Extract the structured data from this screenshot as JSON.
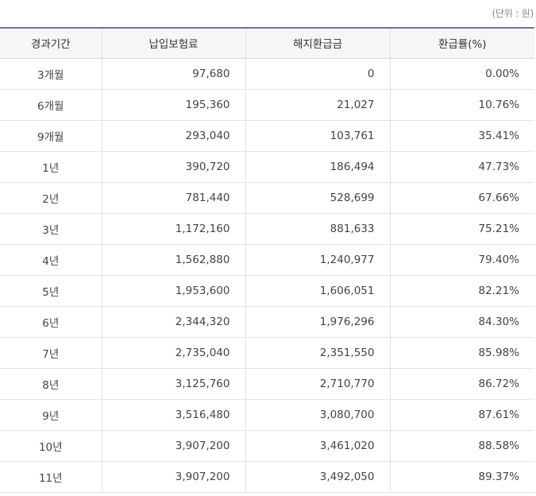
{
  "unit_note": "(단위 : 원)",
  "table": {
    "headers": [
      "경과기간",
      "납입보험료",
      "해지환급금",
      "환급률(%)"
    ],
    "rows": [
      [
        "3개월",
        "97,680",
        "0",
        "0.00%"
      ],
      [
        "6개월",
        "195,360",
        "21,027",
        "10.76%"
      ],
      [
        "9개월",
        "293,040",
        "103,761",
        "35.41%"
      ],
      [
        "1년",
        "390,720",
        "186,494",
        "47.73%"
      ],
      [
        "2년",
        "781,440",
        "528,699",
        "67.66%"
      ],
      [
        "3년",
        "1,172,160",
        "881,633",
        "75.21%"
      ],
      [
        "4년",
        "1,562,880",
        "1,240,977",
        "79.40%"
      ],
      [
        "5년",
        "1,953,600",
        "1,606,051",
        "82.21%"
      ],
      [
        "6년",
        "2,344,320",
        "1,976,296",
        "84.30%"
      ],
      [
        "7년",
        "2,735,040",
        "2,351,550",
        "85.98%"
      ],
      [
        "8년",
        "3,125,760",
        "2,710,770",
        "86.72%"
      ],
      [
        "9년",
        "3,516,480",
        "3,080,700",
        "87.61%"
      ],
      [
        "10년",
        "3,907,200",
        "3,461,020",
        "88.58%"
      ],
      [
        "11년",
        "3,907,200",
        "3,492,050",
        "89.37%"
      ]
    ]
  }
}
